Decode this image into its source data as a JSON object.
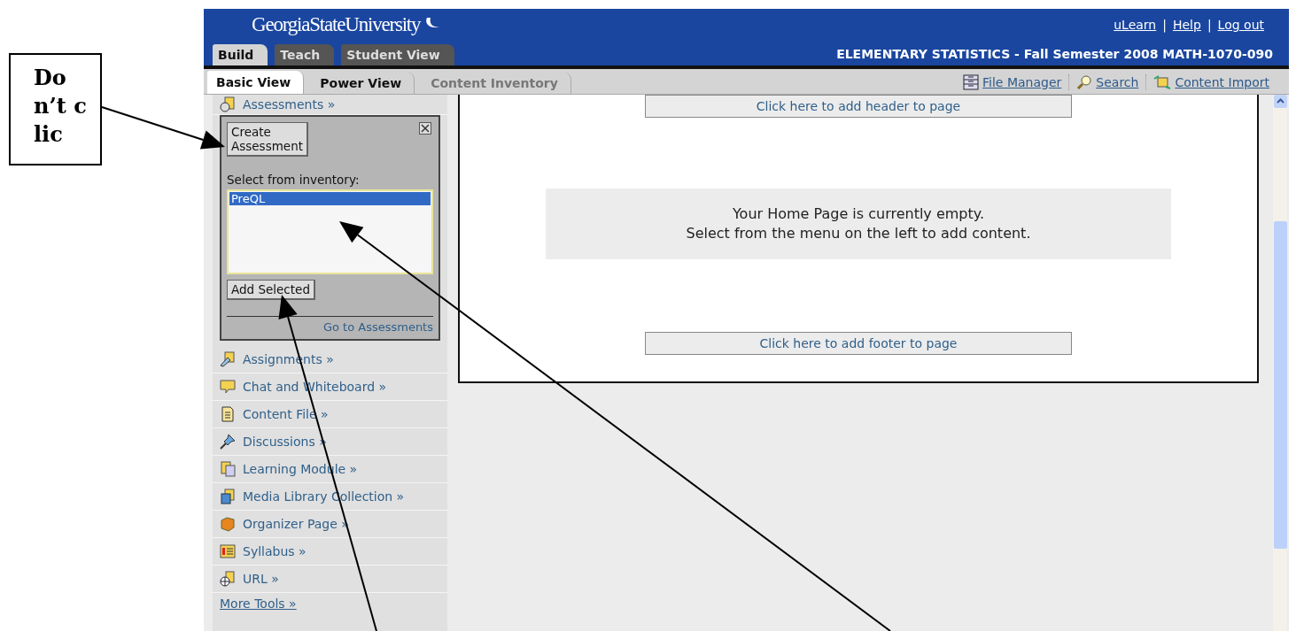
{
  "callout": {
    "text": "Don’t clic"
  },
  "header": {
    "logo": "GeorgiaStateUniversity",
    "links": [
      "uLearn",
      "Help",
      "Log out"
    ],
    "separator": "|"
  },
  "mode_tabs": [
    {
      "label": "Build",
      "selected": true
    },
    {
      "label": "Teach",
      "selected": false
    },
    {
      "label": "Student View",
      "selected": false
    }
  ],
  "course_title": "ELEMENTARY STATISTICS - Fall Semester 2008 MATH-1070-090",
  "view_tabs": [
    {
      "label": "Basic View",
      "selected": true,
      "disabled": false
    },
    {
      "label": "Power View",
      "selected": false,
      "disabled": false
    },
    {
      "label": "Content Inventory",
      "selected": false,
      "disabled": true
    }
  ],
  "tools": [
    {
      "label": "File Manager",
      "kind": "file"
    },
    {
      "label": "Search",
      "kind": "search"
    },
    {
      "label": "Content Import",
      "kind": "import"
    }
  ],
  "sidebar": {
    "items": [
      {
        "label": "Assessments »",
        "kind": "assessments",
        "expanded": true
      },
      {
        "label": "Assignments »",
        "kind": "assignments",
        "expanded": false
      },
      {
        "label": "Chat and Whiteboard »",
        "kind": "chat",
        "expanded": false
      },
      {
        "label": "Content File »",
        "kind": "file",
        "expanded": false
      },
      {
        "label": "Discussions »",
        "kind": "pin",
        "expanded": false
      },
      {
        "label": "Learning Module »",
        "kind": "module",
        "expanded": false
      },
      {
        "label": "Media Library Collection »",
        "kind": "media",
        "expanded": false
      },
      {
        "label": "Organizer Page »",
        "kind": "organizer",
        "expanded": false
      },
      {
        "label": "Syllabus »",
        "kind": "syllabus",
        "expanded": false
      },
      {
        "label": "URL »",
        "kind": "url",
        "expanded": false
      }
    ],
    "panel": {
      "create_button": "Create Assessment",
      "inventory_label": "Select from inventory:",
      "inventory": [
        {
          "label": "PreQL",
          "selected": true
        }
      ],
      "add_button": "Add Selected",
      "footer_link": "Go to Assessments"
    },
    "more_tools": "More Tools »"
  },
  "main": {
    "header_button": "Click here to add header to page",
    "empty_message": "Your Home Page is currently empty.\nSelect from the menu on the left to add content.",
    "footer_button": "Click here to add footer to page"
  }
}
